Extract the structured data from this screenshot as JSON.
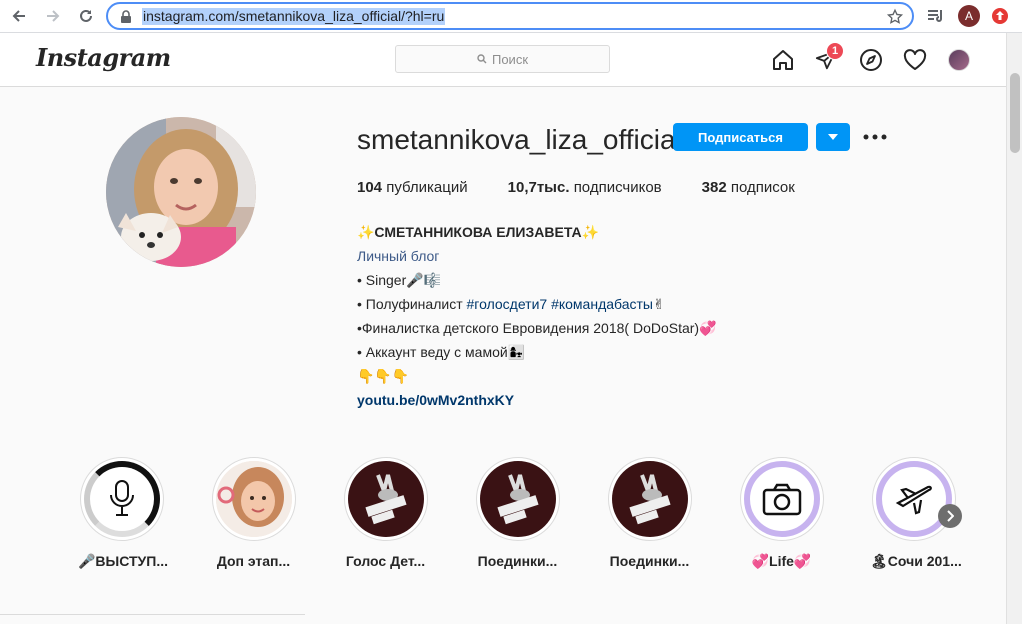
{
  "browser": {
    "url": "instagram.com/smetannikova_liza_official/?hl=ru",
    "profile_initial": "A"
  },
  "header": {
    "logo": "Instagram",
    "search_placeholder": "Поиск",
    "notification_count": "1"
  },
  "profile": {
    "username": "smetannikova_liza_official",
    "follow_label": "Подписаться",
    "stats": {
      "posts_count": "104",
      "posts_label": "публикаций",
      "followers_count": "10,7тыс.",
      "followers_label": "подписчиков",
      "following_count": "382",
      "following_label": "подписок"
    },
    "bio": {
      "name": "✨СМЕТАННИКОВА ЕЛИЗАВЕТА✨",
      "category": "Личный блог",
      "line1": "• Singer🎤🎼",
      "line2_prefix": "• Полуфиналист ",
      "line2_tag1": "#голосдети7",
      "line2_tag2": "#командабасты",
      "line2_suffix": "✌",
      "line3": "•Финалистка детского Евровидения 2018( DoDoStar)💞",
      "line4": "• Аккаунт веду с мамой👩‍👧",
      "line5": "👇👇👇",
      "link": "youtu.be/0wMv2nthxKY"
    }
  },
  "highlights": [
    {
      "label": "🎤ВЫСТУП...",
      "icon": "microphone-icon"
    },
    {
      "label": "Доп этап...",
      "icon": "girl-photo"
    },
    {
      "label": "Голос Дет...",
      "icon": "golos-deti-logo"
    },
    {
      "label": "Поединки...",
      "icon": "golos-deti-logo"
    },
    {
      "label": "Поединки...",
      "icon": "golos-deti-logo"
    },
    {
      "label": "💞Life💞",
      "icon": "camera-icon"
    },
    {
      "label": "🏝Сочи 201...",
      "icon": "airplane-icon"
    }
  ],
  "colors": {
    "accent": "#0095f6",
    "badge": "#ed4956",
    "link": "#00376b"
  }
}
